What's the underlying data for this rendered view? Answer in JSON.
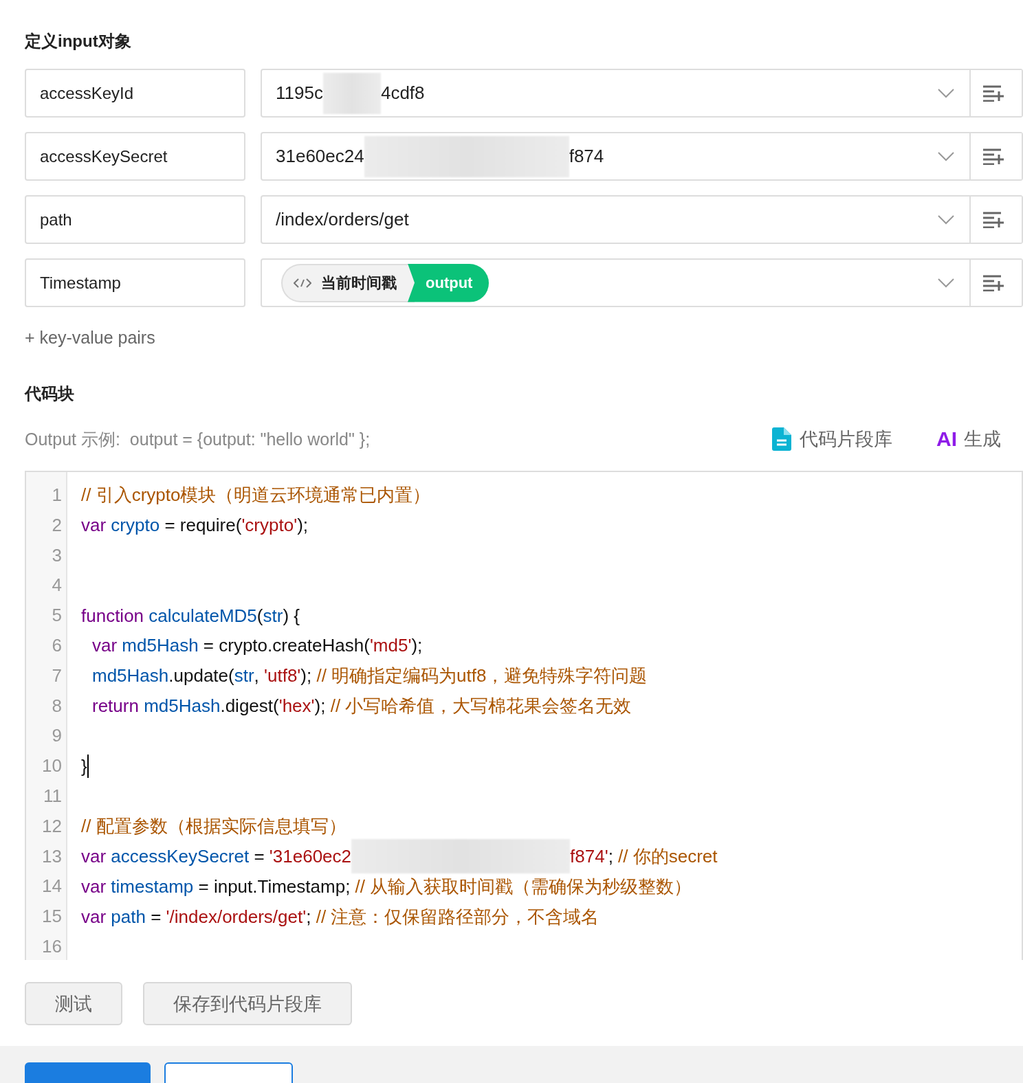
{
  "input_section": {
    "title": "定义input对象",
    "pairs": [
      {
        "key": "accessKeyId",
        "kind": "text",
        "segments": [
          {
            "kind": "text",
            "text": "1195c"
          },
          {
            "kind": "redacted"
          },
          {
            "kind": "text",
            "text": "4cdf8"
          }
        ]
      },
      {
        "key": "accessKeySecret",
        "kind": "text",
        "segments": [
          {
            "kind": "text",
            "text": "31e60ec24"
          },
          {
            "kind": "redacted"
          },
          {
            "kind": "text",
            "text": "f874"
          }
        ]
      },
      {
        "key": "path",
        "kind": "text",
        "segments": [
          {
            "kind": "text",
            "text": "/index/orders/get"
          }
        ]
      },
      {
        "key": "Timestamp",
        "kind": "field_ref",
        "field": "当前时间戳",
        "source": "output"
      }
    ],
    "add_link": "+ key-value pairs"
  },
  "code_section": {
    "title": "代码块",
    "hint": "Output 示例:  output = {output: \"hello world\" };",
    "library_link": "代码片段库",
    "ai_badge": "AI",
    "ai_link": "生成",
    "lines": [
      {
        "number": "1",
        "tokens": [
          {
            "kind": "comment",
            "text": "// 引入crypto模块（明道云环境通常已内置）"
          }
        ]
      },
      {
        "number": "2",
        "tokens": [
          {
            "kind": "keyword",
            "text": "var"
          },
          {
            "kind": "variable",
            "text": " crypto"
          },
          {
            "kind": "plain",
            "text": " = require("
          },
          {
            "kind": "string",
            "text": "'crypto'"
          },
          {
            "kind": "plain",
            "text": ");"
          }
        ]
      },
      {
        "number": "3"
      },
      {
        "number": "4"
      },
      {
        "number": "5",
        "tokens": [
          {
            "kind": "keyword",
            "text": "function"
          },
          {
            "kind": "variable",
            "text": " calculateMD5"
          },
          {
            "kind": "plain",
            "text": "("
          },
          {
            "kind": "variable",
            "text": "str"
          },
          {
            "kind": "plain",
            "text": ") {"
          }
        ]
      },
      {
        "number": "6",
        "indent": true,
        "tokens": [
          {
            "kind": "keyword",
            "text": "var"
          },
          {
            "kind": "variable",
            "text": " md5Hash"
          },
          {
            "kind": "plain",
            "text": " = crypto.createHash("
          },
          {
            "kind": "string",
            "text": "'md5'"
          },
          {
            "kind": "plain",
            "text": ");"
          }
        ]
      },
      {
        "number": "7",
        "indent": true,
        "tokens": [
          {
            "kind": "variable",
            "text": "md5Hash"
          },
          {
            "kind": "plain",
            "text": ".update("
          },
          {
            "kind": "variable",
            "text": "str"
          },
          {
            "kind": "plain",
            "text": ", "
          },
          {
            "kind": "string",
            "text": "'utf8'"
          },
          {
            "kind": "plain",
            "text": "); "
          },
          {
            "kind": "comment",
            "text": "// 明确指定编码为utf8，避免特殊字符问题"
          }
        ]
      },
      {
        "number": "8",
        "indent": true,
        "tokens": [
          {
            "kind": "keyword",
            "text": "return"
          },
          {
            "kind": "variable",
            "text": " md5Hash"
          },
          {
            "kind": "plain",
            "text": ".digest("
          },
          {
            "kind": "string",
            "text": "'hex'"
          },
          {
            "kind": "plain",
            "text": "); "
          },
          {
            "kind": "comment",
            "text": "// 小写哈希值，大写棉花果会签名无效"
          }
        ]
      },
      {
        "number": "9"
      },
      {
        "number": "10",
        "cursor": true,
        "tokens": [
          {
            "kind": "plain",
            "text": "}"
          }
        ]
      },
      {
        "number": "11"
      },
      {
        "number": "12",
        "tokens": [
          {
            "kind": "comment",
            "text": "// 配置参数（根据实际信息填写）"
          }
        ]
      },
      {
        "number": "13",
        "tokens": [
          {
            "kind": "keyword",
            "text": "var"
          },
          {
            "kind": "variable",
            "text": " accessKeySecret"
          },
          {
            "kind": "plain",
            "text": " = "
          },
          {
            "kind": "string",
            "text": "'31e60ec2"
          },
          {
            "kind": "redacted"
          },
          {
            "kind": "string",
            "text": "f874'"
          },
          {
            "kind": "plain",
            "text": "; "
          },
          {
            "kind": "comment",
            "text": "// 你的secret"
          }
        ]
      },
      {
        "number": "14",
        "tokens": [
          {
            "kind": "keyword",
            "text": "var"
          },
          {
            "kind": "variable",
            "text": " timestamp"
          },
          {
            "kind": "plain",
            "text": " = input.Timestamp; "
          },
          {
            "kind": "comment",
            "text": "// 从输入获取时间戳（需确保为秒级整数）"
          }
        ]
      },
      {
        "number": "15",
        "tokens": [
          {
            "kind": "keyword",
            "text": "var"
          },
          {
            "kind": "variable",
            "text": " path"
          },
          {
            "kind": "plain",
            "text": " = "
          },
          {
            "kind": "string",
            "text": "'/index/orders/get'"
          },
          {
            "kind": "plain",
            "text": "; "
          },
          {
            "kind": "comment",
            "text": "// 注意：仅保留路径部分，不含域名"
          }
        ]
      },
      {
        "number": "16"
      }
    ],
    "buttons": [
      "测试",
      "保存到代码片段库"
    ]
  },
  "footer": {
    "buttons": [
      {
        "kind": "primary"
      },
      {
        "kind": "outline"
      }
    ]
  }
}
